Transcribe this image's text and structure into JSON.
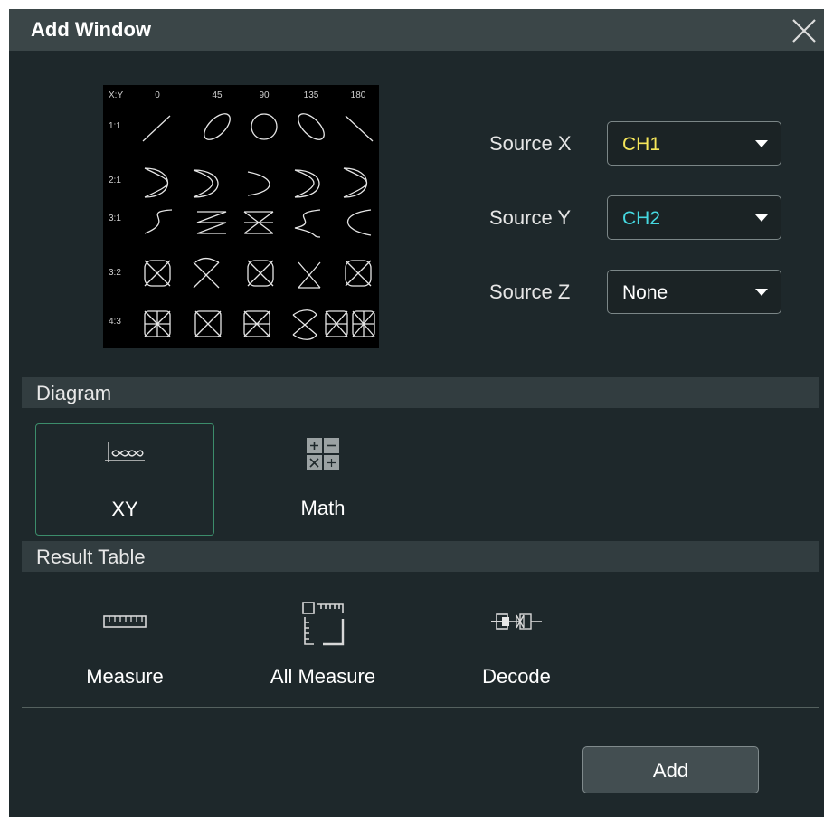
{
  "dialog": {
    "title": "Add Window"
  },
  "lissajous": {
    "header": "X:Y",
    "phases": [
      "0",
      "45",
      "90",
      "135",
      "180"
    ],
    "ratios": [
      "1:1",
      "2:1",
      "3:1",
      "3:2",
      "4:3"
    ]
  },
  "sources": [
    {
      "label": "Source X",
      "value": "CH1",
      "value_color": "#f5e65a"
    },
    {
      "label": "Source Y",
      "value": "CH2",
      "value_color": "#45d8e0"
    },
    {
      "label": "Source Z",
      "value": "None",
      "value_color": "#ffffff"
    }
  ],
  "diagram": {
    "section_label": "Diagram",
    "items": [
      {
        "label": "XY",
        "icon": "xy-icon",
        "selected": true
      },
      {
        "label": "Math",
        "icon": "math-icon",
        "selected": false
      }
    ]
  },
  "result_table": {
    "section_label": "Result Table",
    "items": [
      {
        "label": "Measure",
        "icon": "ruler-icon"
      },
      {
        "label": "All Measure",
        "icon": "all-measure-icon"
      },
      {
        "label": "Decode",
        "icon": "decode-icon"
      }
    ]
  },
  "footer": {
    "add_label": "Add"
  },
  "colors": {
    "accent_selected": "#3c8d6b",
    "background": "#1e282b",
    "titlebar": "#3b4648"
  }
}
